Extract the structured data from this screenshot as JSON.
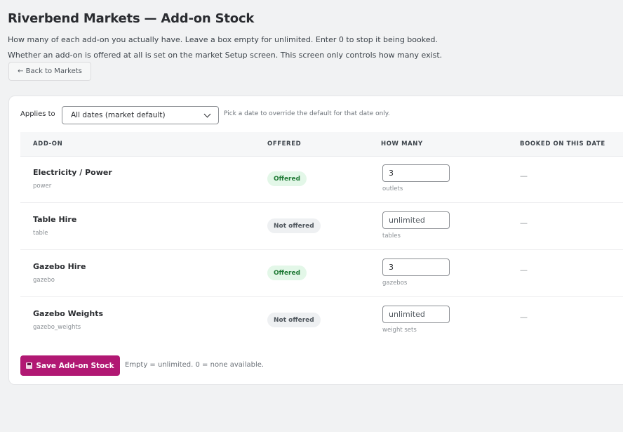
{
  "page": {
    "title": "Riverbend Markets — Add-on Stock",
    "description_1": "How many of each add-on you actually have. Leave a box empty for unlimited. Enter 0 to stop it being booked.",
    "description_2": "Whether an add-on is offered at all is set on the market Setup screen. This screen only controls how many exist.",
    "back_label": "← Back to Markets"
  },
  "filter": {
    "label": "Applies to",
    "selected": "All dates (market default)",
    "hint": "Pick a date to override the default for that date only."
  },
  "table": {
    "headers": {
      "addon": "ADD-ON",
      "offered": "OFFERED",
      "how_many": "HOW MANY",
      "booked": "BOOKED ON THIS DATE"
    },
    "rows": [
      {
        "name": "Electricity / Power",
        "key": "power",
        "status": "Offered",
        "value": "3",
        "placeholder": "unlimited",
        "unit": "outlets",
        "booked": "—"
      },
      {
        "name": "Table Hire",
        "key": "table",
        "status": "Not offered",
        "value": "",
        "placeholder": "unlimited",
        "unit": "tables",
        "booked": "—"
      },
      {
        "name": "Gazebo Hire",
        "key": "gazebo",
        "status": "Offered",
        "value": "3",
        "placeholder": "unlimited",
        "unit": "gazebos",
        "booked": "—"
      },
      {
        "name": "Gazebo Weights",
        "key": "gazebo_weights",
        "status": "Not offered",
        "value": "",
        "placeholder": "unlimited",
        "unit": "weight sets",
        "booked": "—"
      }
    ]
  },
  "footer": {
    "save_label": "Save Add-on Stock",
    "save_icon": "floppy-disk-icon",
    "hint": "Empty = unlimited. 0 = none available."
  },
  "colors": {
    "accent": "#b11873",
    "offered_bg": "#e3f7e8",
    "offered_text": "#1f7a35",
    "not_offered_bg": "#eef0f2"
  }
}
